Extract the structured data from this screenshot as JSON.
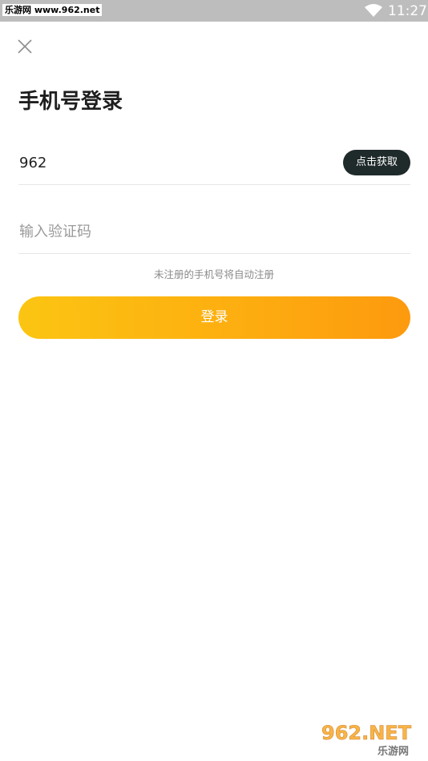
{
  "status_bar": {
    "watermark": "乐游网 www.962.net",
    "time": "11:27"
  },
  "page": {
    "title": "手机号登录"
  },
  "phone": {
    "value": "962",
    "get_code_label": "点击获取"
  },
  "code": {
    "placeholder": "输入验证码",
    "value": ""
  },
  "hint": "未注册的手机号将自动注册",
  "login_button": "登录",
  "watermark_bottom": {
    "brand": "962.NET",
    "name": "乐游网"
  },
  "colors": {
    "button_gradient_start": "#fcc512",
    "button_gradient_end": "#fd9a0e",
    "get_code_bg": "#1f2a2a",
    "status_bar_bg": "#bdbdbd"
  }
}
